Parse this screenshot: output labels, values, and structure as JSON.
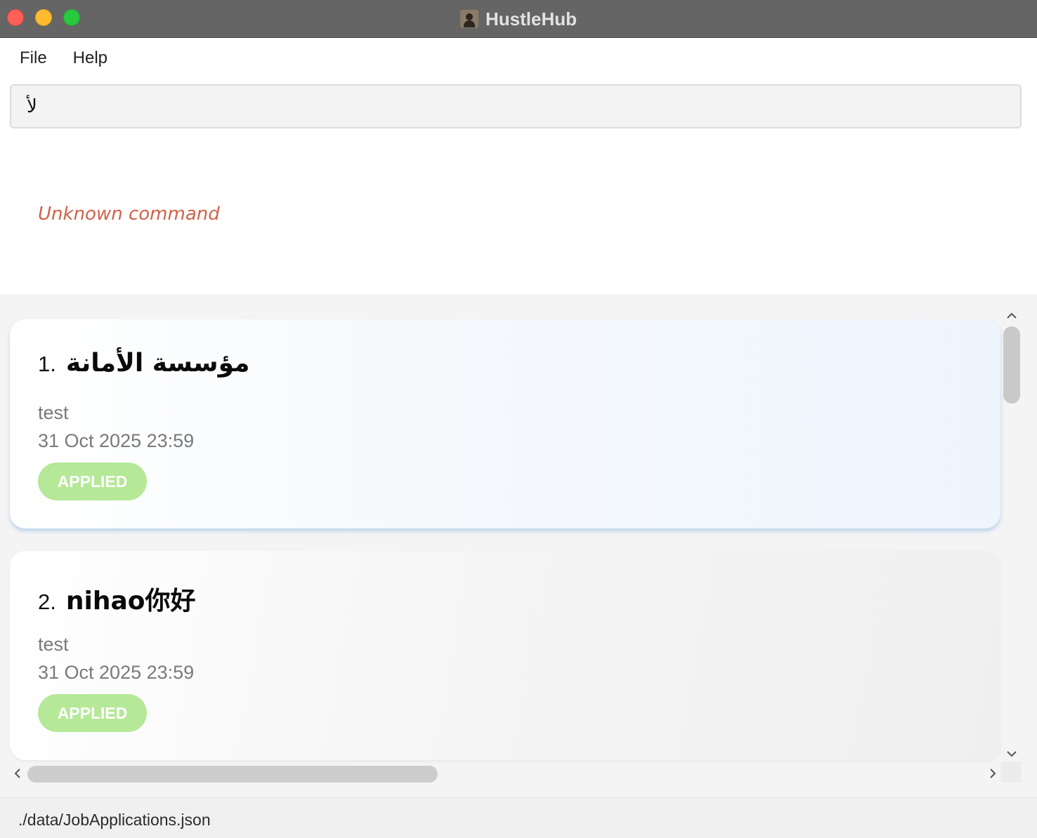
{
  "window": {
    "title": "HustleHub",
    "app_icon": "person-icon"
  },
  "menu": {
    "items": [
      {
        "label": "File"
      },
      {
        "label": "Help"
      }
    ]
  },
  "command": {
    "value": "لأ",
    "placeholder": ""
  },
  "result": {
    "message": "Unknown command",
    "color": "#d0624a"
  },
  "applications": [
    {
      "index": "1.",
      "company": "مؤسسة الأمانة",
      "description": "test",
      "deadline": "31 Oct 2025 23:59",
      "status": "APPLIED"
    },
    {
      "index": "2.",
      "company": "nihao你好",
      "description": "test",
      "deadline": "31 Oct 2025 23:59",
      "status": "APPLIED"
    }
  ],
  "status_bar": {
    "path": "./data/JobApplications.json"
  },
  "colors": {
    "status_applied": "#b5e897",
    "title_bar": "#656565"
  }
}
